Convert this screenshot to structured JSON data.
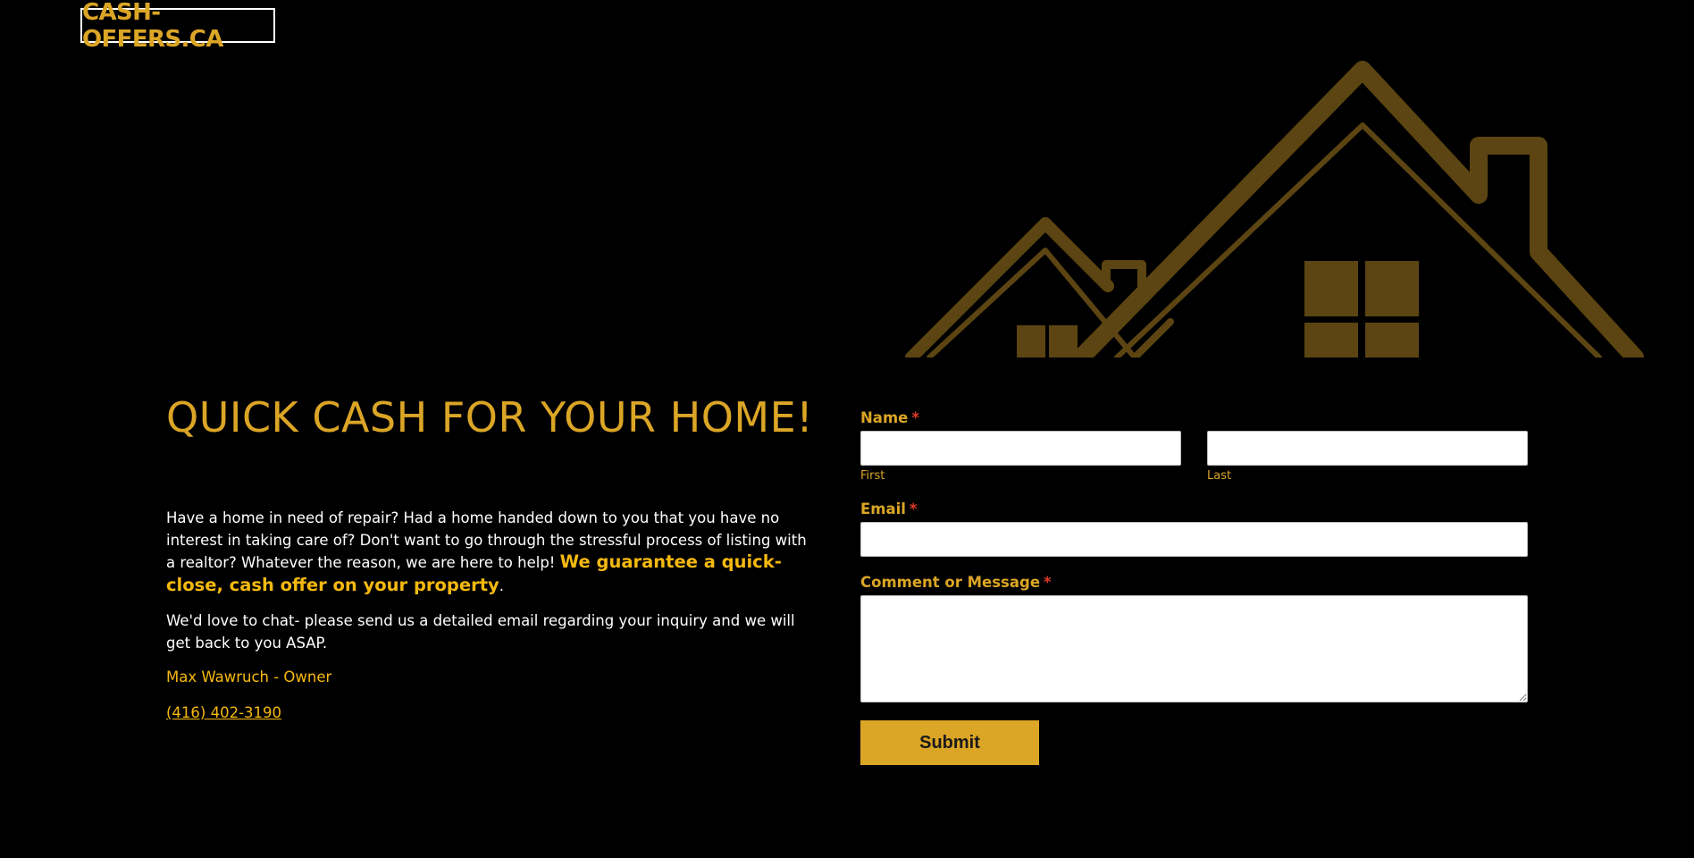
{
  "brand": {
    "logo_text": "CASH-OFFERS.CA"
  },
  "hero": {
    "graphic": "house-roofline-illustration"
  },
  "content": {
    "headline": "QUICK CASH FOR YOUR HOME!",
    "intro_text": "Have a  home in need of repair? Had a home handed down to you that you have no interest in taking care of? Don't want to go through the stressful process of listing with a realtor? Whatever the reason, we are here to help! ",
    "intro_emphasis": "We guarantee a quick-close, cash offer on your property",
    "intro_end": ".",
    "chat_text": "We'd love to chat- please send us a detailed email regarding your inquiry and we will get back to you ASAP.",
    "owner": "Max Wawruch - Owner",
    "phone": "(416) 402-3190"
  },
  "form": {
    "name_label": "Name",
    "first_sublabel": "First",
    "last_sublabel": "Last",
    "email_label": "Email",
    "message_label": "Comment or Message",
    "required_marker": "*",
    "first_value": "",
    "last_value": "",
    "email_value": "",
    "message_value": "",
    "submit_label": "Submit"
  },
  "colors": {
    "background": "#000000",
    "accent": "#dba526",
    "emphasis": "#f5b90f",
    "required": "#e03a2a",
    "hero_graphic": "#5c4512"
  }
}
